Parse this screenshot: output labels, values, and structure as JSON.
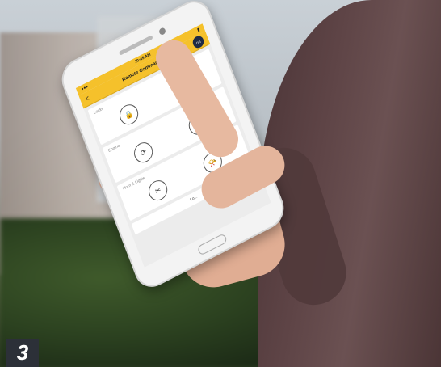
{
  "phone": {
    "status_time": "10:45 AM",
    "app_title": "Remote Commands",
    "back_glyph": "<",
    "badge": "ON",
    "sections": [
      {
        "label": "Locks",
        "controls": [
          "lock-icon",
          "unlock-icon"
        ]
      },
      {
        "label": "Engine",
        "controls": [
          "engine-start-icon",
          "engine-stop-icon"
        ]
      },
      {
        "label": "Horn & Lights",
        "controls": [
          "lights-icon",
          "horn-icon"
        ]
      }
    ],
    "footer_text": "Lo..."
  },
  "figure_number": "3"
}
